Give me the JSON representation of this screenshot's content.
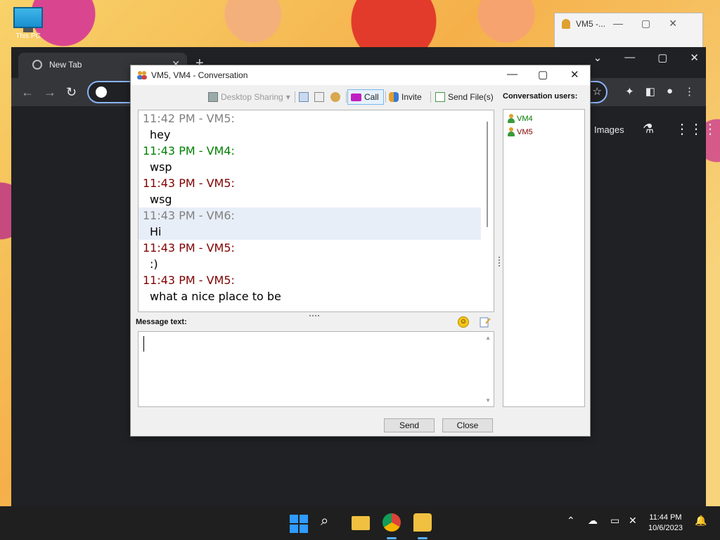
{
  "desktop": {
    "icon_label": "This PC"
  },
  "bg_window": {
    "title": "VM5 -..."
  },
  "chrome": {
    "tab_title": "New Tab",
    "images_link": "Images"
  },
  "conversation": {
    "title": "VM5, VM4 - Conversation",
    "toolbar": {
      "desktop_sharing": "Desktop Sharing",
      "call": "Call",
      "invite": "Invite",
      "send_files": "Send File(s)"
    },
    "users_label": "Conversation users:",
    "users": [
      {
        "name": "VM4",
        "color": "#007a00"
      },
      {
        "name": "VM5",
        "color": "#800000"
      }
    ],
    "messages": [
      {
        "header": "11:42 PM - VM5:",
        "text": "hey",
        "color": "#808080"
      },
      {
        "header": "11:43 PM - VM4:",
        "text": "wsp",
        "color": "#008000"
      },
      {
        "header": "11:43 PM - VM5:",
        "text": "wsg",
        "color": "#800000"
      },
      {
        "header": "11:43 PM - VM6:",
        "text": "Hi",
        "color": "#808080"
      },
      {
        "header": "11:43 PM - VM5:",
        "text": ":)",
        "color": "#800000"
      },
      {
        "header": "11:43 PM - VM5:",
        "text": "what a nice place to be",
        "color": "#800000"
      }
    ],
    "message_label": "Message text:",
    "message_value": "",
    "send_button": "Send",
    "close_button": "Close"
  },
  "taskbar": {
    "time": "11:44 PM",
    "date": "10/6/2023"
  }
}
